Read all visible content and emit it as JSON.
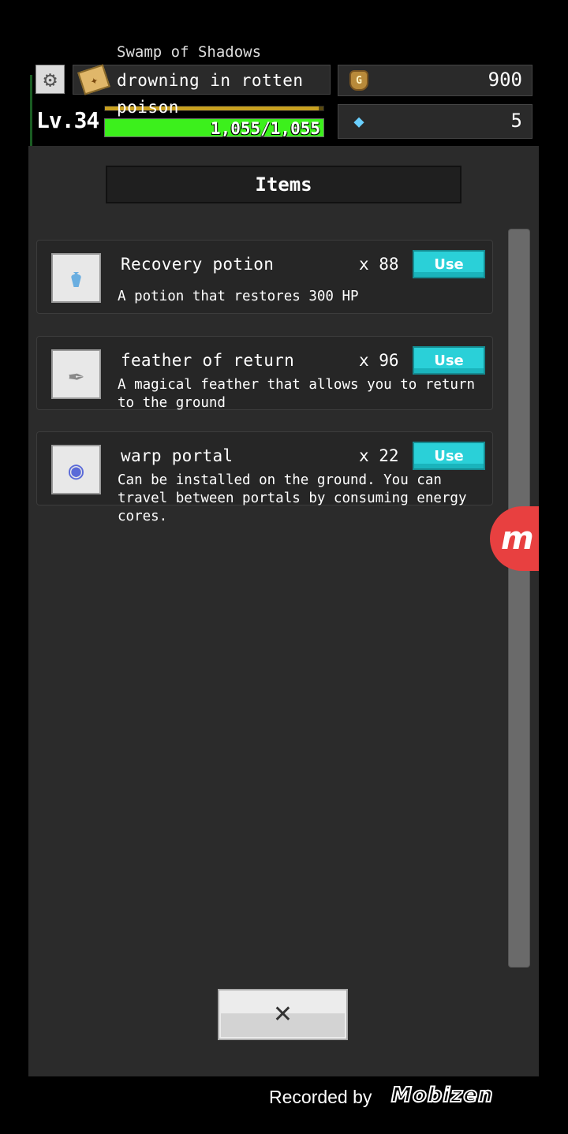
{
  "hud": {
    "area_name": "Swamp of Shadows",
    "quest_line1": "drowning in rotten",
    "quest_line2": "poison",
    "level_label": "Lv.34",
    "xp_fraction": 0.98,
    "hp_text": "1,055/1,055",
    "hp_fraction": 1.0,
    "gold": "900",
    "gems": "5",
    "settings_icon": "gear-icon",
    "quest_icon": "map-scroll-icon",
    "gold_icon": "gold-bag-icon",
    "gem_icon": "rainbow-gem-icon"
  },
  "panel": {
    "title": "Items",
    "items": [
      {
        "name": "Recovery potion",
        "qty": "x 88",
        "use_label": "Use",
        "description": "A potion that restores 300 HP",
        "icon": "potion-bottle-icon"
      },
      {
        "name": "feather of return",
        "qty": "x 96",
        "use_label": "Use",
        "description": "A magical feather that allows you to return to the ground",
        "icon": "feather-quill-icon"
      },
      {
        "name": "warp portal",
        "qty": "x 22",
        "use_label": "Use",
        "description": "Can be installed on the ground. You can travel between portals by consuming energy cores.",
        "icon": "portal-swirl-icon"
      }
    ],
    "close_glyph": "✕"
  },
  "overlay": {
    "recorded_by": "Recorded by",
    "recorder_brand": "Mobizen",
    "badge_glyph": "m"
  },
  "colors": {
    "hp_bar": "#3cf01c",
    "xp_bar": "#c8a020",
    "use_button": "#2ad0d8",
    "panel_bg": "#2b2b2b",
    "mobizen_red": "#e84040"
  }
}
